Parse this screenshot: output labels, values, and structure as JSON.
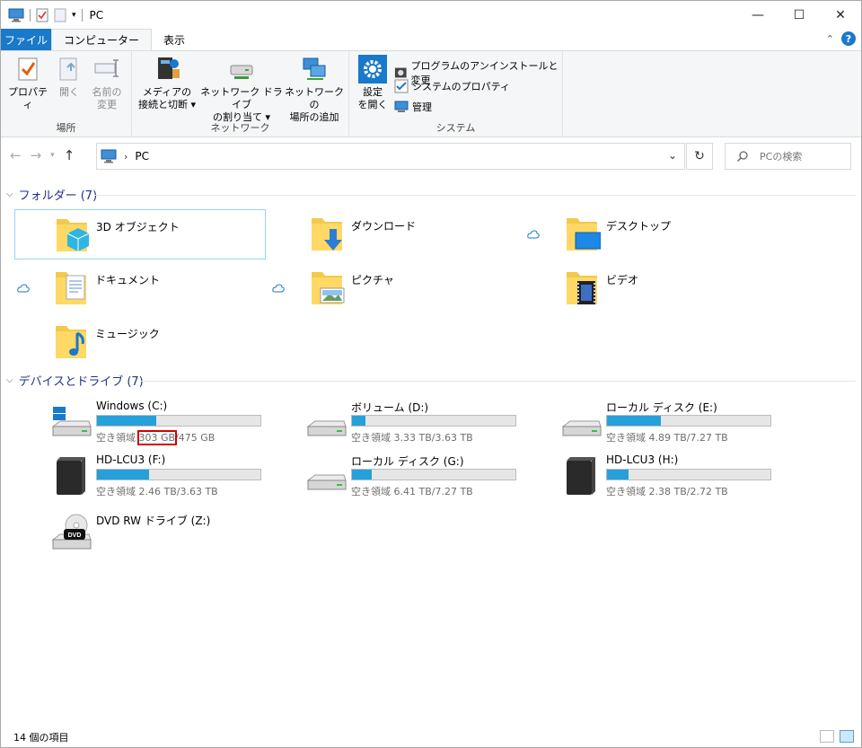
{
  "window": {
    "title": "PC",
    "minimize": "—",
    "maximize": "☐",
    "close": "✕"
  },
  "tabs": [
    {
      "label": "ファイル"
    },
    {
      "label": "コンピューター"
    },
    {
      "label": "表示"
    }
  ],
  "ribbon": {
    "groups": {
      "location": "場所",
      "network": "ネットワーク",
      "system": "システム"
    },
    "properties": {
      "line1": "プロパティ",
      "line2": ""
    },
    "open": {
      "line1": "開く",
      "line2": ""
    },
    "rename": {
      "line1": "名前の",
      "line2": "変更"
    },
    "media": {
      "line1": "メディアの",
      "line2": "接続と切断 ▾"
    },
    "map_drive": {
      "line1": "ネットワーク ドライブ",
      "line2": "の割り当て ▾"
    },
    "add_location": {
      "line1": "ネットワークの",
      "line2": "場所の追加"
    },
    "settings": {
      "line1": "設定",
      "line2": "を開く"
    },
    "uninstall": "プログラムのアンインストールと変更",
    "sys_props": "システムのプロパティ",
    "manage": "管理"
  },
  "address": {
    "path": "PC",
    "search_placeholder": "PCの検索"
  },
  "folders": {
    "heading": "フォルダー (7)",
    "items": [
      {
        "name": "3D オブジェクト"
      },
      {
        "name": "ダウンロード"
      },
      {
        "name": "デスクトップ"
      },
      {
        "name": "ドキュメント"
      },
      {
        "name": "ピクチャ"
      },
      {
        "name": "ビデオ"
      },
      {
        "name": "ミュージック"
      }
    ]
  },
  "drives": {
    "heading": "デバイスとドライブ (7)",
    "items": [
      {
        "name": "Windows (C:)",
        "free_prefix": "空き領域 ",
        "free": "303 GB",
        "total_suffix": "/475 GB",
        "used_fraction": 0.36
      },
      {
        "name": "ボリューム (D:)",
        "free_text": "空き領域 3.33 TB/3.63 TB",
        "used_fraction": 0.08
      },
      {
        "name": "ローカル ディスク (E:)",
        "free_text": "空き領域 4.89 TB/7.27 TB",
        "used_fraction": 0.33
      },
      {
        "name": "HD-LCU3 (F:)",
        "free_text": "空き領域 2.46 TB/3.63 TB",
        "used_fraction": 0.32
      },
      {
        "name": "ローカル ディスク (G:)",
        "free_text": "空き領域 6.41 TB/7.27 TB",
        "used_fraction": 0.12
      },
      {
        "name": "HD-LCU3 (H:)",
        "free_text": "空き領域 2.38 TB/2.72 TB",
        "used_fraction": 0.13
      },
      {
        "name": "DVD RW ドライブ (Z:)"
      }
    ]
  },
  "status": {
    "count": "14 個の項目"
  },
  "colors": {
    "accent": "#1979ca",
    "bar_fill": "#26a0da",
    "highlight": "#d40000",
    "section_heading": "#1e3287"
  }
}
